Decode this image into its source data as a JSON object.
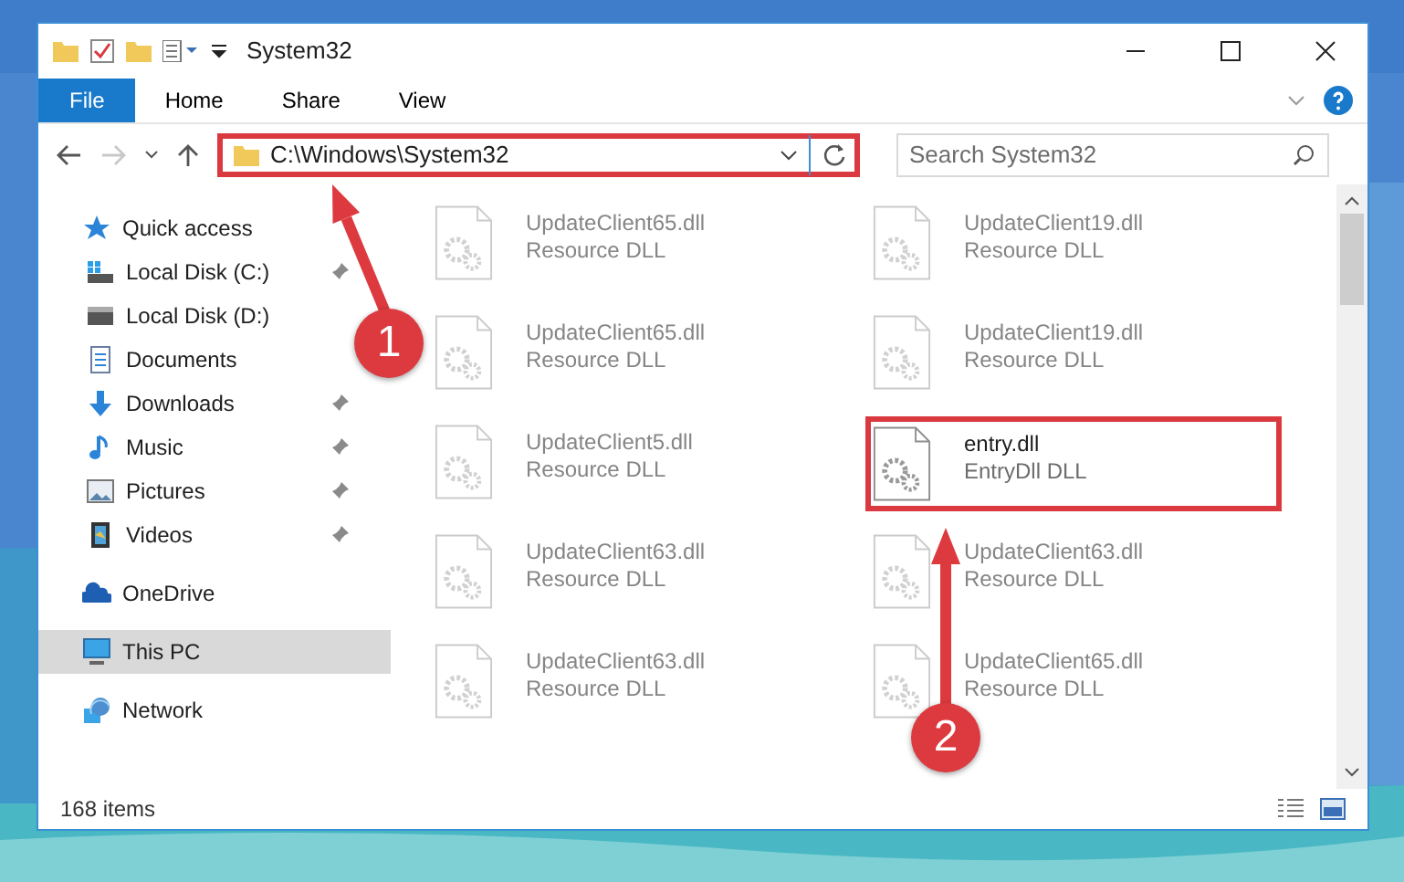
{
  "window": {
    "title": "System32"
  },
  "ribbon_tabs": [
    {
      "label": "File",
      "kind": "file",
      "selected": false
    },
    {
      "label": "Home",
      "kind": "tab",
      "selected": false
    },
    {
      "label": "Share",
      "kind": "tab",
      "selected": false
    },
    {
      "label": "View",
      "kind": "tab",
      "selected": false
    }
  ],
  "address_bar": {
    "path": "C:\\Windows\\System32",
    "highlighted": true
  },
  "search": {
    "placeholder": "Search System32"
  },
  "navigation": [
    {
      "label": "Quick access",
      "kind": "star",
      "selected": false,
      "children": [
        {
          "label": "Local Disk (C:)",
          "kind": "windows-drive",
          "pinned": true,
          "selected": false
        },
        {
          "label": "Local Disk (D:)",
          "kind": "drive",
          "pinned": false,
          "selected": false
        },
        {
          "label": "Documents",
          "kind": "documents",
          "pinned": false,
          "selected": false
        },
        {
          "label": "Downloads",
          "kind": "downloads",
          "pinned": true,
          "selected": false
        },
        {
          "label": "Music",
          "kind": "music",
          "pinned": true,
          "selected": false
        },
        {
          "label": "Pictures",
          "kind": "pictures",
          "pinned": true,
          "selected": false
        },
        {
          "label": "Videos",
          "kind": "videos",
          "pinned": true,
          "selected": false
        }
      ]
    },
    {
      "label": "OneDrive",
      "kind": "cloud",
      "selected": false
    },
    {
      "label": "This PC",
      "kind": "computer",
      "selected": true
    },
    {
      "label": "Network",
      "kind": "network",
      "selected": false
    }
  ],
  "files": [
    {
      "name": "UpdateClient65.dll",
      "type": "Resource DLL",
      "faded": true,
      "highlighted": false
    },
    {
      "name": "UpdateClient19.dll",
      "type": "Resource DLL",
      "faded": true,
      "highlighted": false
    },
    {
      "name": "UpdateClient65.dll",
      "type": "Resource DLL",
      "faded": true,
      "highlighted": false
    },
    {
      "name": "UpdateClient19.dll",
      "type": "Resource DLL",
      "faded": true,
      "highlighted": false
    },
    {
      "name": "UpdateClient5.dll",
      "type": "Resource DLL",
      "faded": true,
      "highlighted": false
    },
    {
      "name": "entry.dll",
      "type": "EntryDll DLL",
      "faded": false,
      "highlighted": true
    },
    {
      "name": "UpdateClient63.dll",
      "type": "Resource DLL",
      "faded": true,
      "highlighted": false
    },
    {
      "name": "UpdateClient63.dll",
      "type": "Resource DLL",
      "faded": true,
      "highlighted": false
    },
    {
      "name": "UpdateClient63.dll",
      "type": "Resource DLL",
      "faded": true,
      "highlighted": false
    },
    {
      "name": "UpdateClient65.dll",
      "type": "Resource DLL",
      "faded": true,
      "highlighted": false
    }
  ],
  "status_bar": {
    "item_count": "168 items"
  },
  "annotations": [
    {
      "label": "1"
    },
    {
      "label": "2"
    }
  ]
}
